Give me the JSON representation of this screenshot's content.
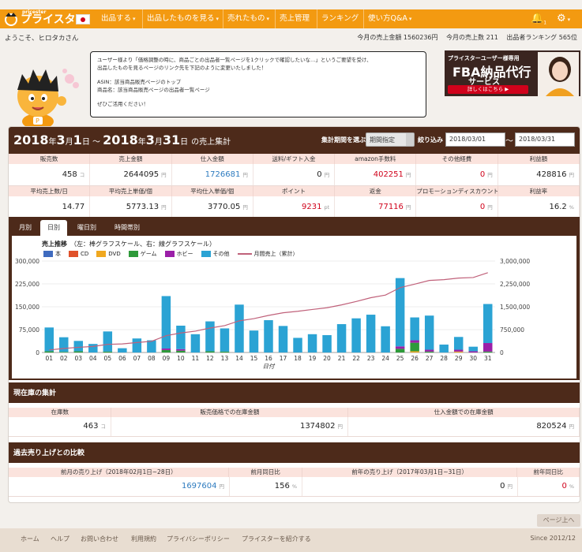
{
  "nav": {
    "logo": "プライスター",
    "logo_small": "pricester",
    "items": [
      {
        "label": "出品する",
        "caret": true
      },
      {
        "label": "出品したものを見る",
        "caret": true
      },
      {
        "label": "売れたもの",
        "caret": true
      },
      {
        "label": "売上管理",
        "caret": false
      },
      {
        "label": "ランキング",
        "caret": false
      },
      {
        "label": "使い方Q&A",
        "caret": true
      }
    ],
    "bell_count": "1",
    "colors": {
      "accent": "#f39a11",
      "dark": "#4d2a1a"
    }
  },
  "header": {
    "welcome": "ようこそ、ヒロタカさん",
    "stats": [
      "今月の売上金額 1560236円",
      "今月の売上数 211",
      "出品者ランキング 565位"
    ]
  },
  "message": {
    "lines": [
      "ユーザー様より「価格調整の時に、商品ごとの出品者一覧ページを1クリックで確認したいな…」というご要望を受け、",
      "出品したものを見るページのリンク先を下記のように変更いたしました！",
      "",
      "ASIN：該当商品販売ページのトップ",
      "商品名：該当商品販売ページの出品者一覧ページ",
      "",
      "ぜひご活用ください！"
    ]
  },
  "ad": {
    "top": "プライスターユーザー様専用",
    "title": "FBA納品代行",
    "sub": "サービス",
    "button": "詳しくはこちら ▶"
  },
  "sales": {
    "title_parts": [
      "2018",
      "年",
      "3",
      "月",
      "1",
      "日 ～ ",
      "2018",
      "年",
      "3",
      "月",
      "31",
      "日",
      "の売上集計"
    ],
    "period_label": "集計期間を選ぶ",
    "period_value": "期間指定",
    "filter_label": "絞り込み",
    "date_from": "2018/03/01",
    "date_to": "2018/03/31",
    "tilde": "～",
    "row1_headers": [
      "販売数",
      "売上金額",
      "仕入金額",
      "送料/ギフト入金",
      "amazon手数料",
      "その他経費",
      "利益額"
    ],
    "row1_values": [
      {
        "v": "458",
        "u": "コ",
        "c": ""
      },
      {
        "v": "2644095",
        "u": "円",
        "c": ""
      },
      {
        "v": "1726681",
        "u": "円",
        "c": "blue"
      },
      {
        "v": "0",
        "u": "円",
        "c": ""
      },
      {
        "v": "402251",
        "u": "円",
        "c": "red"
      },
      {
        "v": "0",
        "u": "円",
        "c": "red"
      },
      {
        "v": "428816",
        "u": "円",
        "c": ""
      }
    ],
    "row2_headers": [
      "平均売上数/日",
      "平均売上単価/個",
      "平均仕入単価/個",
      "ポイント",
      "返金",
      "プロモーションディスカウント",
      "利益率"
    ],
    "row2_values": [
      {
        "v": "14.77",
        "u": "",
        "c": ""
      },
      {
        "v": "5773.13",
        "u": "円",
        "c": ""
      },
      {
        "v": "3770.05",
        "u": "円",
        "c": ""
      },
      {
        "v": "9231",
        "u": "pt",
        "c": "red"
      },
      {
        "v": "77116",
        "u": "円",
        "c": "red"
      },
      {
        "v": "0",
        "u": "円",
        "c": "red"
      },
      {
        "v": "16.2",
        "u": "%",
        "c": ""
      }
    ]
  },
  "tabs": [
    "月別",
    "日別",
    "曜日別",
    "時間帯別"
  ],
  "chart_data": {
    "type": "bar",
    "title": "売上推移",
    "subtitle": "（左：棒グラフスケール、右：線グラフスケール）",
    "xlabel": "日付",
    "categories": [
      "01",
      "02",
      "03",
      "04",
      "05",
      "06",
      "07",
      "08",
      "09",
      "10",
      "11",
      "12",
      "13",
      "14",
      "15",
      "16",
      "17",
      "18",
      "19",
      "20",
      "21",
      "22",
      "23",
      "24",
      "25",
      "26",
      "27",
      "28",
      "29",
      "30",
      "31"
    ],
    "ylim": [
      0,
      300000
    ],
    "y_ticks": [
      "0",
      "75,000",
      "150,000",
      "225,000",
      "300,000"
    ],
    "y2lim": [
      0,
      3000000
    ],
    "y2_ticks": [
      "0",
      "750,000",
      "1,500,000",
      "2,250,000",
      "3,000,000"
    ],
    "stacked": true,
    "series": [
      {
        "name": "本",
        "color": "#3f6bbf",
        "values": [
          0,
          0,
          0,
          0,
          0,
          0,
          0,
          0,
          0,
          0,
          0,
          0,
          0,
          0,
          0,
          0,
          0,
          0,
          0,
          0,
          0,
          0,
          0,
          0,
          0,
          0,
          0,
          0,
          0,
          0,
          0
        ]
      },
      {
        "name": "CD",
        "color": "#e0512a",
        "values": [
          0,
          0,
          0,
          0,
          0,
          0,
          0,
          0,
          0,
          0,
          0,
          0,
          0,
          0,
          0,
          0,
          0,
          0,
          0,
          0,
          0,
          0,
          0,
          0,
          0,
          0,
          0,
          0,
          0,
          0,
          0
        ]
      },
      {
        "name": "DVD",
        "color": "#f0a820",
        "values": [
          0,
          0,
          0,
          0,
          0,
          0,
          0,
          0,
          0,
          0,
          0,
          0,
          0,
          0,
          0,
          0,
          0,
          0,
          0,
          0,
          0,
          0,
          0,
          0,
          0,
          4000,
          0,
          0,
          3000,
          0,
          0
        ]
      },
      {
        "name": "ゲーム",
        "color": "#2e9a3a",
        "values": [
          4000,
          2000,
          4000,
          0,
          3000,
          0,
          0,
          0,
          8000,
          6000,
          0,
          4000,
          3000,
          0,
          0,
          0,
          0,
          0,
          0,
          0,
          0,
          0,
          0,
          0,
          12000,
          28000,
          3000,
          0,
          0,
          0,
          3000
        ]
      },
      {
        "name": "ホビー",
        "color": "#9b1fa8",
        "values": [
          0,
          0,
          0,
          0,
          0,
          0,
          0,
          0,
          5000,
          5000,
          0,
          0,
          0,
          0,
          0,
          0,
          0,
          0,
          0,
          0,
          0,
          0,
          0,
          0,
          8000,
          8000,
          6000,
          0,
          6000,
          4000,
          28000
        ]
      },
      {
        "name": "その他",
        "color": "#2ba3d4",
        "values": [
          78000,
          48000,
          34000,
          28000,
          66000,
          14000,
          46000,
          40000,
          172000,
          77000,
          60000,
          98000,
          76000,
          157000,
          72000,
          106000,
          87000,
          48000,
          60000,
          57000,
          93000,
          112000,
          124000,
          86000,
          224000,
          75000,
          112000,
          26000,
          42000,
          15000,
          128000
        ]
      }
    ],
    "line": {
      "name": "月間売上（累計）",
      "color": "#c0617a",
      "values": [
        82000,
        132000,
        170000,
        198000,
        267000,
        281000,
        327000,
        367000,
        552000,
        640000,
        700000,
        802000,
        881000,
        1038000,
        1110000,
        1216000,
        1303000,
        1351000,
        1411000,
        1468000,
        1561000,
        1673000,
        1797000,
        1883000,
        2127000,
        2242000,
        2363000,
        2389000,
        2440000,
        2459000,
        2618000
      ]
    }
  },
  "stock": {
    "title": "現在庫の集計",
    "headers": [
      "在庫数",
      "販売価格での在庫金額",
      "仕入金額での在庫金額"
    ],
    "values": [
      {
        "v": "463",
        "u": "コ"
      },
      {
        "v": "1374802",
        "u": "円"
      },
      {
        "v": "820524",
        "u": "円"
      }
    ]
  },
  "compare": {
    "title": "過去売り上げとの比較",
    "headers": [
      "前月の売り上げ（2018年02月1日~28日）",
      "前月同日比",
      "前年の売り上げ（2017年03月1日~31日）",
      "前年同日比"
    ],
    "values": [
      {
        "v": "1697604",
        "u": "円",
        "c": "blue"
      },
      {
        "v": "156",
        "u": "%",
        "c": ""
      },
      {
        "v": "0",
        "u": "円",
        "c": ""
      },
      {
        "v": "0",
        "u": "%",
        "c": "red"
      }
    ]
  },
  "footer": {
    "links": [
      "ホーム",
      "ヘルプ",
      "お問い合わせ",
      "利用規約",
      "プライバシーポリシー",
      "プライスターを紹介する"
    ],
    "since": "Since 2012/12",
    "pagetop": "ページ上へ"
  }
}
